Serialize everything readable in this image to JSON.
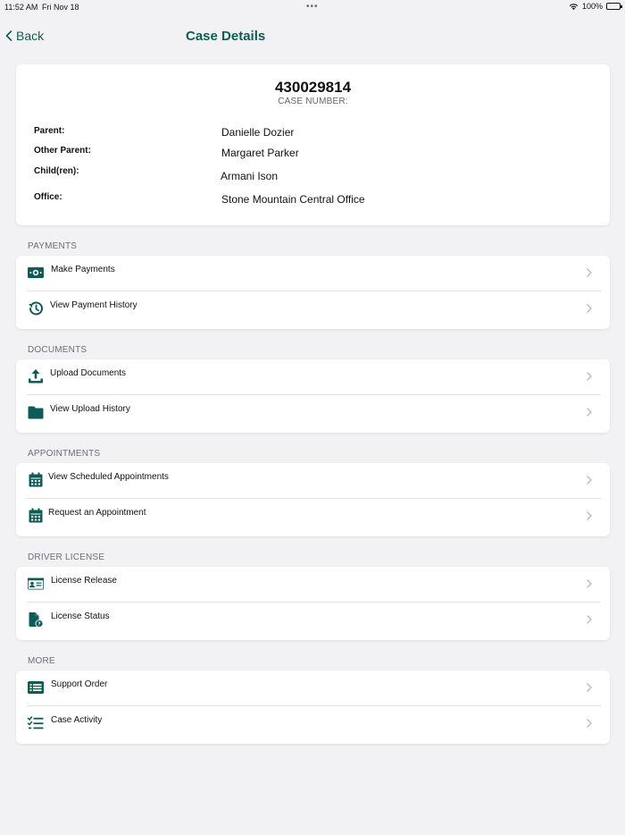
{
  "status_bar": {
    "time": "11:52 AM",
    "date": "Fri Nov 18",
    "battery": "100%"
  },
  "nav": {
    "back_label": "Back",
    "title": "Case Details"
  },
  "case": {
    "number": "430029814",
    "number_label": "CASE NUMBER:",
    "fields": [
      {
        "label": "Parent:",
        "value": "Danielle Dozier"
      },
      {
        "label": "Other Parent:",
        "value": "Margaret Parker"
      },
      {
        "label": "Child(ren):",
        "value": "Armani Ison"
      },
      {
        "label": "Office:",
        "value": "Stone Mountain Central Office"
      }
    ]
  },
  "sections": {
    "payments": {
      "header": "PAYMENTS",
      "items": [
        {
          "label": "Make Payments",
          "icon": "money-icon"
        },
        {
          "label": "View Payment History",
          "icon": "history-icon"
        }
      ]
    },
    "documents": {
      "header": "DOCUMENTS",
      "items": [
        {
          "label": "Upload Documents",
          "icon": "upload-icon"
        },
        {
          "label": "View Upload History",
          "icon": "folder-icon"
        }
      ]
    },
    "appointments": {
      "header": "APPOINTMENTS",
      "items": [
        {
          "label": "View Scheduled Appointments",
          "icon": "calendar-icon"
        },
        {
          "label": "Request an Appointment",
          "icon": "calendar-icon"
        }
      ]
    },
    "driver_license": {
      "header": "DRIVER LICENSE",
      "items": [
        {
          "label": "License Release",
          "icon": "id-card-icon"
        },
        {
          "label": "License Status",
          "icon": "file-question-icon"
        }
      ]
    },
    "more": {
      "header": "MORE",
      "items": [
        {
          "label": "Support Order",
          "icon": "list-icon"
        },
        {
          "label": "Case Activity",
          "icon": "checklist-icon"
        }
      ]
    }
  },
  "colors": {
    "accent": "#0f5b56",
    "background": "#f2f2f4",
    "chevron": "#b8b8bd"
  }
}
